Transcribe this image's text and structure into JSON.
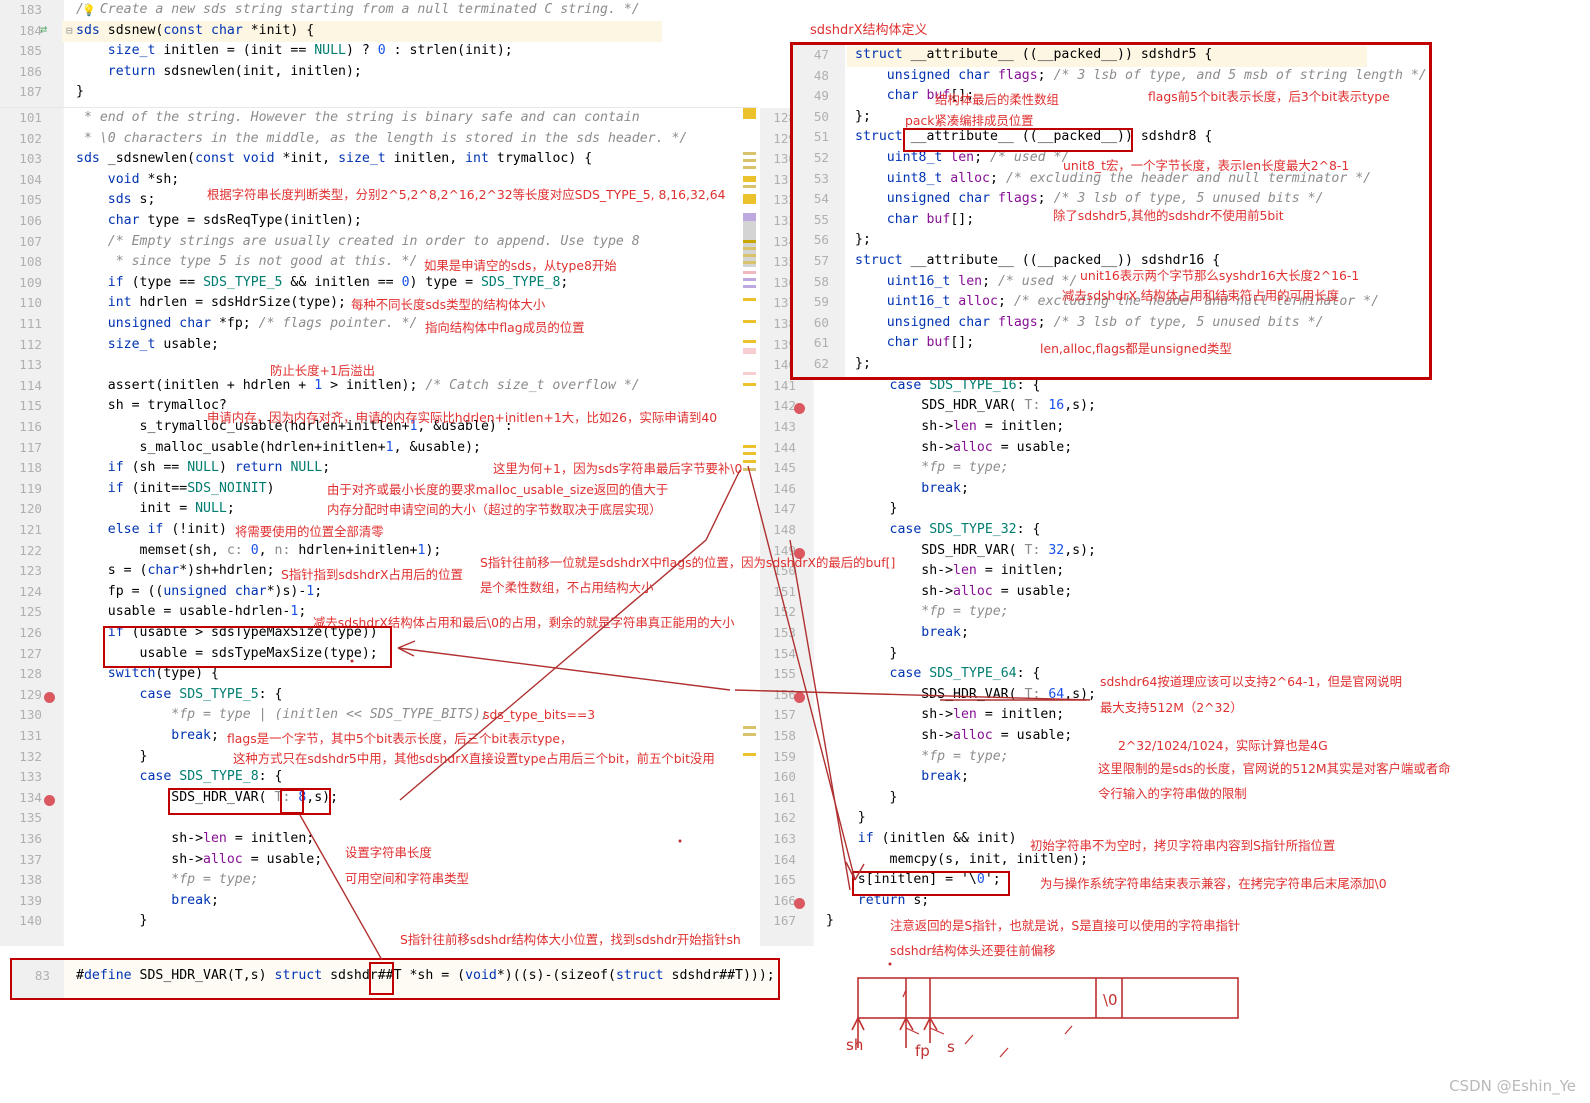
{
  "meta": {
    "watermark": "CSDN @Eshin_Ye",
    "accent_red": "#e03030",
    "box_red": "#c00000",
    "breakpoint_color": "#db5860",
    "highlight_yellow": "#fcf6e3",
    "breakpoint_row": "#fbeaea"
  },
  "left_editor_top": {
    "lines": [
      {
        "n": "183",
        "text": "/* Create a new sds string starting from a null terminated C string. */"
      },
      {
        "n": "184",
        "text": "sds sdsnew(const char *init) {"
      },
      {
        "n": "185",
        "text": "    size_t initlen = (init == NULL) ? 0 : strlen(init);"
      },
      {
        "n": "186",
        "text": "    return sdsnewlen(init, initlen);"
      },
      {
        "n": "187",
        "text": "}"
      }
    ]
  },
  "left_editor_main": {
    "lines": [
      {
        "n": "101",
        "text": " * end of the string. However the string is binary safe and can contain"
      },
      {
        "n": "102",
        "text": " * \\0 characters in the middle, as the length is stored in the sds header. */"
      },
      {
        "n": "103",
        "text": "sds _sdsnewlen(const void *init, size_t initlen, int trymalloc) {"
      },
      {
        "n": "104",
        "text": "    void *sh;"
      },
      {
        "n": "105",
        "text": "    sds s;"
      },
      {
        "n": "106",
        "text": "    char type = sdsReqType(initlen);"
      },
      {
        "n": "107",
        "text": "    /* Empty strings are usually created in order to append. Use type 8"
      },
      {
        "n": "108",
        "text": "     * since type 5 is not good at this. */"
      },
      {
        "n": "109",
        "text": "    if (type == SDS_TYPE_5 && initlen == 0) type = SDS_TYPE_8;"
      },
      {
        "n": "110",
        "text": "    int hdrlen = sdsHdrSize(type);"
      },
      {
        "n": "111",
        "text": "    unsigned char *fp; /* flags pointer. */"
      },
      {
        "n": "112",
        "text": "    size_t usable;"
      },
      {
        "n": "113",
        "text": ""
      },
      {
        "n": "114",
        "text": "    assert(initlen + hdrlen + 1 > initlen); /* Catch size_t overflow */"
      },
      {
        "n": "115",
        "text": "    sh = trymalloc?"
      },
      {
        "n": "116",
        "text": "        s_trymalloc_usable(hdrlen+initlen+1, &usable) :"
      },
      {
        "n": "117",
        "text": "        s_malloc_usable(hdrlen+initlen+1, &usable);"
      },
      {
        "n": "118",
        "text": "    if (sh == NULL) return NULL;"
      },
      {
        "n": "119",
        "text": "    if (init==SDS_NOINIT)"
      },
      {
        "n": "120",
        "text": "        init = NULL;"
      },
      {
        "n": "121",
        "text": "    else if (!init)"
      },
      {
        "n": "122",
        "text": "        memset(sh, c: 0, n: hdrlen+initlen+1);"
      },
      {
        "n": "123",
        "text": "    s = (char*)sh+hdrlen;"
      },
      {
        "n": "124",
        "text": "    fp = ((unsigned char*)s)-1;"
      },
      {
        "n": "125",
        "text": "    usable = usable-hdrlen-1;"
      },
      {
        "n": "126",
        "text": "    if (usable > sdsTypeMaxSize(type))"
      },
      {
        "n": "127",
        "text": "        usable = sdsTypeMaxSize(type);"
      },
      {
        "n": "128",
        "text": "    switch(type) {"
      },
      {
        "n": "129",
        "text": "        case SDS_TYPE_5: {"
      },
      {
        "n": "130",
        "text": "            *fp = type | (initlen << SDS_TYPE_BITS);"
      },
      {
        "n": "131",
        "text": "            break;"
      },
      {
        "n": "132",
        "text": "        }"
      },
      {
        "n": "133",
        "text": "        case SDS_TYPE_8: {"
      },
      {
        "n": "134",
        "text": "            SDS_HDR_VAR( T: 8,s);"
      },
      {
        "n": "135",
        "text": ""
      },
      {
        "n": "136",
        "text": "            sh->len = initlen;"
      },
      {
        "n": "137",
        "text": "            sh->alloc = usable;"
      },
      {
        "n": "138",
        "text": "            *fp = type;"
      },
      {
        "n": "139",
        "text": "            break;"
      },
      {
        "n": "140",
        "text": "        }"
      }
    ]
  },
  "left_editor_define": {
    "lines": [
      {
        "n": "83",
        "text": "#define SDS_HDR_VAR(T,s) struct sdshdr##T *sh = (void*)((s)-(sizeof(struct sdshdr##T)));"
      }
    ]
  },
  "right_editor": {
    "lines": [
      {
        "n": "128",
        "text": ""
      },
      {
        "n": "129",
        "text": ""
      },
      {
        "n": "130",
        "text": ""
      },
      {
        "n": "131",
        "text": ""
      },
      {
        "n": "132",
        "text": ""
      },
      {
        "n": "133",
        "text": ""
      },
      {
        "n": "134",
        "text": ""
      },
      {
        "n": "135",
        "text": ""
      },
      {
        "n": "136",
        "text": ""
      },
      {
        "n": "137",
        "text": ""
      },
      {
        "n": "138",
        "text": ""
      },
      {
        "n": "139",
        "text": ""
      },
      {
        "n": "140",
        "text": ""
      },
      {
        "n": "141",
        "text": "        case SDS_TYPE_16: {"
      },
      {
        "n": "142",
        "text": "            SDS_HDR_VAR( T: 16,s);"
      },
      {
        "n": "143",
        "text": "            sh->len = initlen;"
      },
      {
        "n": "144",
        "text": "            sh->alloc = usable;"
      },
      {
        "n": "145",
        "text": "            *fp = type;"
      },
      {
        "n": "146",
        "text": "            break;"
      },
      {
        "n": "147",
        "text": "        }"
      },
      {
        "n": "148",
        "text": "        case SDS_TYPE_32: {"
      },
      {
        "n": "149",
        "text": "            SDS_HDR_VAR( T: 32,s);"
      },
      {
        "n": "150",
        "text": "            sh->len = initlen;"
      },
      {
        "n": "151",
        "text": "            sh->alloc = usable;"
      },
      {
        "n": "152",
        "text": "            *fp = type;"
      },
      {
        "n": "153",
        "text": "            break;"
      },
      {
        "n": "154",
        "text": "        }"
      },
      {
        "n": "155",
        "text": "        case SDS_TYPE_64: {"
      },
      {
        "n": "156",
        "text": "            SDS_HDR_VAR( T: 64,s);"
      },
      {
        "n": "157",
        "text": "            sh->len = initlen;"
      },
      {
        "n": "158",
        "text": "            sh->alloc = usable;"
      },
      {
        "n": "159",
        "text": "            *fp = type;"
      },
      {
        "n": "160",
        "text": "            break;"
      },
      {
        "n": "161",
        "text": "        }"
      },
      {
        "n": "162",
        "text": "    }"
      },
      {
        "n": "163",
        "text": "    if (initlen && init)"
      },
      {
        "n": "164",
        "text": "        memcpy(s, init, initlen);"
      },
      {
        "n": "165",
        "text": "    s[initlen] = '\\0';"
      },
      {
        "n": "166",
        "text": "    return s;"
      },
      {
        "n": "167",
        "text": "}"
      }
    ]
  },
  "struct_overlay": {
    "title": "sdshdrX结构体定义",
    "lines": [
      {
        "n": "47",
        "text": "struct __attribute__ ((__packed__)) sdshdr5 {"
      },
      {
        "n": "48",
        "text": "    unsigned char flags; /* 3 lsb of type, and 5 msb of string length */"
      },
      {
        "n": "49",
        "text": "    char buf[];"
      },
      {
        "n": "50",
        "text": "};"
      },
      {
        "n": "51",
        "text": "struct __attribute__ ((__packed__)) sdshdr8 {"
      },
      {
        "n": "52",
        "text": "    uint8_t len; /* used */"
      },
      {
        "n": "53",
        "text": "    uint8_t alloc; /* excluding the header and null terminator */"
      },
      {
        "n": "54",
        "text": "    unsigned char flags; /* 3 lsb of type, 5 unused bits */"
      },
      {
        "n": "55",
        "text": "    char buf[];"
      },
      {
        "n": "56",
        "text": "};"
      },
      {
        "n": "57",
        "text": "struct __attribute__ ((__packed__)) sdshdr16 {"
      },
      {
        "n": "58",
        "text": "    uint16_t len; /* used */"
      },
      {
        "n": "59",
        "text": "    uint16_t alloc; /* excluding the header and null terminator */"
      },
      {
        "n": "60",
        "text": "    unsigned char flags; /* 3 lsb of type, 5 unused bits */"
      },
      {
        "n": "61",
        "text": "    char buf[];"
      },
      {
        "n": "62",
        "text": "};"
      }
    ]
  },
  "annotations": {
    "a_struct_title": "sdshdrX结构体定义",
    "a_flexible_array": "结构体最后的柔性数组",
    "a_flags_bits": "flags前5个bit表示长度，后3个bit表示type",
    "a_pack": "pack紧凑编排成员位置",
    "a_uint8": "unit8_t宏，一个字节长度，表示len长度最大2^8-1",
    "a_no_first5bit": "除了sdshdr5,其他的sdshdr不使用前5bit",
    "a_uint16_1": "unit16表示两个字节那么syshdr16大长度2^16-1",
    "a_uint16_2": "减去sdshdrX 结构体占用和结束符占用的可用长度",
    "a_unsigned_types": "len,alloc,flags都是unsigned类型",
    "a_type_by_len": "根据字符串长度判断类型，分别2^5,2^8,2^16,2^32等长度对应SDS_TYPE_5, 8,16,32,64",
    "a_empty_sds": "如果是申请空的sds，从type8开始",
    "a_hdrsize": "每种不同长度sds类型的结构体大小",
    "a_flag_pointer": "指向结构体中flag成员的位置",
    "a_overflow": "防止长度+1后溢出",
    "a_malloc_align": "申请内存，因为内存对齐，申请的内存实际比hdrlen+initlen+1大，比如26，实际申请到40",
    "a_plus_one": "这里为何+1，因为sds字符串最后字节要补\\0",
    "a_usable_1": "由于对齐或最小长度的要求malloc_usable_size返回的值大于",
    "a_usable_2": "内存分配时申请空间的大小（超过的字节数取决于底层实现）",
    "a_memset": "将需要使用的位置全部清零",
    "a_s_pointer": "S指针指到sdshdrX占用后的位置",
    "a_fp_1": "S指针往前移一位就是sdshdrX中flags的位置，因为sdshdrX的最后的buf[]",
    "a_fp_2": "是个柔性数组，不占用结构大小",
    "a_usable_calc": "减去sdshdrX结构体占用和最后\\0的占用，剩余的就是字符串真正能用的大小",
    "a_sds_type_bits": "sds_type_bits==3",
    "a_flags_byte_1": "flags是一个字节，其中5个bit表示长度，后三个bit表示type，",
    "a_flags_byte_2": "这种方式只在sdshdr5中用，其他sdshdrX直接设置type占用后三个bit，前五个bit没用",
    "a_set_len": "设置字符串长度",
    "a_avail_type": "可用空间和字符串类型",
    "a_sh_offset": "S指针往前移sdshdr结构体大小位置，找到sdshdr开始指针sh",
    "a_hdr64_1": "sdshdr64按道理应该可以支持2^64-1，但是官网说明",
    "a_hdr64_2": "最大支持512M（2^32）",
    "a_4g": "2^32/1024/1024，实际计算也是4G",
    "a_512m_1": "这里限制的是sds的长度，官网说的512M其实是对客户端或者命",
    "a_512m_2": "令行输入的字符串做的限制",
    "a_memcpy": "初始字符串不为空时，拷贝字符串内容到S指针所指位置",
    "a_null_term": "为与操作系统字符串结束表示兼容，在拷完字符串后末尾添加\\0",
    "a_return_s": "注意返回的是S指针，也就是说，S是直接可以使用的字符串指针",
    "a_sdshdr_offset": "sdshdr结构体头还要往前偏移"
  },
  "memory_diagram": {
    "null_cell_label": "\\0",
    "pointers": [
      {
        "label": "sh"
      },
      {
        "label": "fp"
      },
      {
        "label": "s"
      }
    ]
  }
}
